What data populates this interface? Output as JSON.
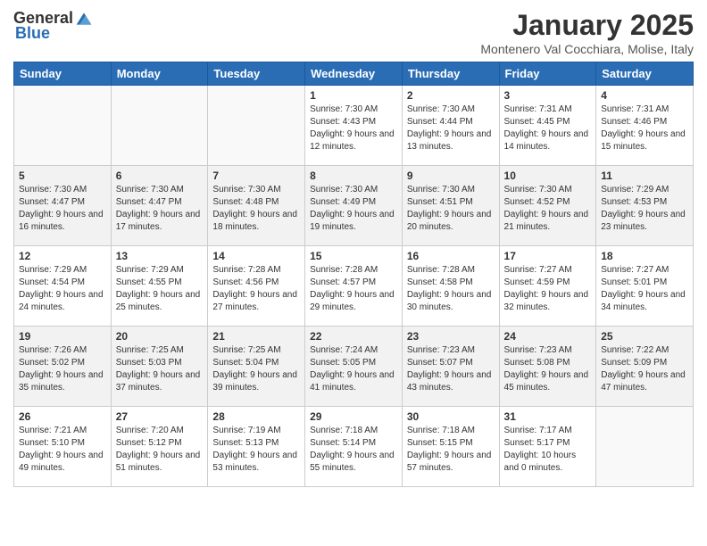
{
  "logo": {
    "general": "General",
    "blue": "Blue"
  },
  "title": "January 2025",
  "subtitle": "Montenero Val Cocchiara, Molise, Italy",
  "headers": [
    "Sunday",
    "Monday",
    "Tuesday",
    "Wednesday",
    "Thursday",
    "Friday",
    "Saturday"
  ],
  "weeks": [
    [
      {
        "day": "",
        "info": ""
      },
      {
        "day": "",
        "info": ""
      },
      {
        "day": "",
        "info": ""
      },
      {
        "day": "1",
        "info": "Sunrise: 7:30 AM\nSunset: 4:43 PM\nDaylight: 9 hours and 12 minutes."
      },
      {
        "day": "2",
        "info": "Sunrise: 7:30 AM\nSunset: 4:44 PM\nDaylight: 9 hours and 13 minutes."
      },
      {
        "day": "3",
        "info": "Sunrise: 7:31 AM\nSunset: 4:45 PM\nDaylight: 9 hours and 14 minutes."
      },
      {
        "day": "4",
        "info": "Sunrise: 7:31 AM\nSunset: 4:46 PM\nDaylight: 9 hours and 15 minutes."
      }
    ],
    [
      {
        "day": "5",
        "info": "Sunrise: 7:30 AM\nSunset: 4:47 PM\nDaylight: 9 hours and 16 minutes."
      },
      {
        "day": "6",
        "info": "Sunrise: 7:30 AM\nSunset: 4:47 PM\nDaylight: 9 hours and 17 minutes."
      },
      {
        "day": "7",
        "info": "Sunrise: 7:30 AM\nSunset: 4:48 PM\nDaylight: 9 hours and 18 minutes."
      },
      {
        "day": "8",
        "info": "Sunrise: 7:30 AM\nSunset: 4:49 PM\nDaylight: 9 hours and 19 minutes."
      },
      {
        "day": "9",
        "info": "Sunrise: 7:30 AM\nSunset: 4:51 PM\nDaylight: 9 hours and 20 minutes."
      },
      {
        "day": "10",
        "info": "Sunrise: 7:30 AM\nSunset: 4:52 PM\nDaylight: 9 hours and 21 minutes."
      },
      {
        "day": "11",
        "info": "Sunrise: 7:29 AM\nSunset: 4:53 PM\nDaylight: 9 hours and 23 minutes."
      }
    ],
    [
      {
        "day": "12",
        "info": "Sunrise: 7:29 AM\nSunset: 4:54 PM\nDaylight: 9 hours and 24 minutes."
      },
      {
        "day": "13",
        "info": "Sunrise: 7:29 AM\nSunset: 4:55 PM\nDaylight: 9 hours and 25 minutes."
      },
      {
        "day": "14",
        "info": "Sunrise: 7:28 AM\nSunset: 4:56 PM\nDaylight: 9 hours and 27 minutes."
      },
      {
        "day": "15",
        "info": "Sunrise: 7:28 AM\nSunset: 4:57 PM\nDaylight: 9 hours and 29 minutes."
      },
      {
        "day": "16",
        "info": "Sunrise: 7:28 AM\nSunset: 4:58 PM\nDaylight: 9 hours and 30 minutes."
      },
      {
        "day": "17",
        "info": "Sunrise: 7:27 AM\nSunset: 4:59 PM\nDaylight: 9 hours and 32 minutes."
      },
      {
        "day": "18",
        "info": "Sunrise: 7:27 AM\nSunset: 5:01 PM\nDaylight: 9 hours and 34 minutes."
      }
    ],
    [
      {
        "day": "19",
        "info": "Sunrise: 7:26 AM\nSunset: 5:02 PM\nDaylight: 9 hours and 35 minutes."
      },
      {
        "day": "20",
        "info": "Sunrise: 7:25 AM\nSunset: 5:03 PM\nDaylight: 9 hours and 37 minutes."
      },
      {
        "day": "21",
        "info": "Sunrise: 7:25 AM\nSunset: 5:04 PM\nDaylight: 9 hours and 39 minutes."
      },
      {
        "day": "22",
        "info": "Sunrise: 7:24 AM\nSunset: 5:05 PM\nDaylight: 9 hours and 41 minutes."
      },
      {
        "day": "23",
        "info": "Sunrise: 7:23 AM\nSunset: 5:07 PM\nDaylight: 9 hours and 43 minutes."
      },
      {
        "day": "24",
        "info": "Sunrise: 7:23 AM\nSunset: 5:08 PM\nDaylight: 9 hours and 45 minutes."
      },
      {
        "day": "25",
        "info": "Sunrise: 7:22 AM\nSunset: 5:09 PM\nDaylight: 9 hours and 47 minutes."
      }
    ],
    [
      {
        "day": "26",
        "info": "Sunrise: 7:21 AM\nSunset: 5:10 PM\nDaylight: 9 hours and 49 minutes."
      },
      {
        "day": "27",
        "info": "Sunrise: 7:20 AM\nSunset: 5:12 PM\nDaylight: 9 hours and 51 minutes."
      },
      {
        "day": "28",
        "info": "Sunrise: 7:19 AM\nSunset: 5:13 PM\nDaylight: 9 hours and 53 minutes."
      },
      {
        "day": "29",
        "info": "Sunrise: 7:18 AM\nSunset: 5:14 PM\nDaylight: 9 hours and 55 minutes."
      },
      {
        "day": "30",
        "info": "Sunrise: 7:18 AM\nSunset: 5:15 PM\nDaylight: 9 hours and 57 minutes."
      },
      {
        "day": "31",
        "info": "Sunrise: 7:17 AM\nSunset: 5:17 PM\nDaylight: 10 hours and 0 minutes."
      },
      {
        "day": "",
        "info": ""
      }
    ]
  ]
}
